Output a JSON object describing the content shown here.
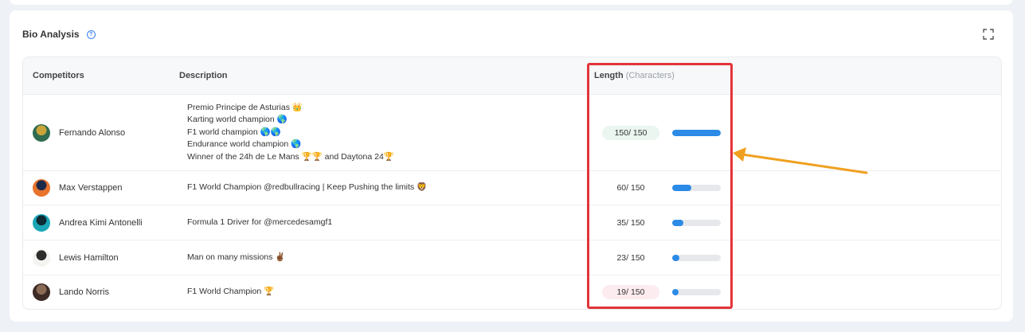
{
  "card": {
    "title": "Bio Analysis"
  },
  "columns": {
    "competitors": "Competitors",
    "description": "Description",
    "length": "Length",
    "length_unit": "(Characters)"
  },
  "max_length": 150,
  "rows": [
    {
      "name": "Fernando Alonso",
      "description_lines": [
        "Premio Principe de Asturias 👑",
        "Karting world champion 🌎",
        "F1 world champion 🌎🌎",
        "Endurance world champion 🌎",
        "Winner of the 24h de Le Mans 🏆🏆 and Daytona 24🏆"
      ],
      "length_text": "150/ 150",
      "length": 150,
      "pill_color": "#eaf6ef",
      "avatar_colors": [
        "#2f6b4f",
        "#c9a43a"
      ]
    },
    {
      "name": "Max Verstappen",
      "description_lines": [
        "F1 World Champion @redbullracing | Keep Pushing the limits 🦁"
      ],
      "length_text": "60/ 150",
      "length": 60,
      "pill_color": "",
      "avatar_colors": [
        "#e8742c",
        "#1c2a4a"
      ]
    },
    {
      "name": "Andrea Kimi Antonelli",
      "description_lines": [
        "Formula 1 Driver for @mercedesamgf1"
      ],
      "length_text": "35/ 150",
      "length": 35,
      "pill_color": "",
      "avatar_colors": [
        "#1aa6b7",
        "#0e2a33"
      ]
    },
    {
      "name": "Lewis Hamilton",
      "description_lines": [
        "Man on many missions ✌🏾"
      ],
      "length_text": "23/ 150",
      "length": 23,
      "pill_color": "",
      "avatar_colors": [
        "#f3f3f0",
        "#2d2d2d"
      ]
    },
    {
      "name": "Lando Norris",
      "description_lines": [
        "F1 World Champion 🏆"
      ],
      "length_text": "19/ 150",
      "length": 19,
      "pill_color": "#fdecef",
      "avatar_colors": [
        "#3b2a25",
        "#8a6a55"
      ]
    }
  ],
  "colors": {
    "bar": "#2b8be6",
    "highlight": "#e3343a",
    "arrow": "#f0a020"
  }
}
